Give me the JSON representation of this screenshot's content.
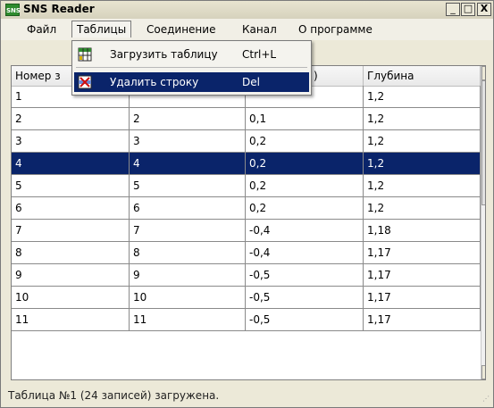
{
  "window": {
    "title": "SNS Reader",
    "icon_text": "SNS",
    "controls": [
      "_",
      "□",
      "X"
    ]
  },
  "menu": [
    "Файл",
    "Таблицы",
    "Соединение",
    "Канал",
    "О программе"
  ],
  "dropdown": [
    {
      "label": "Загрузить таблицу",
      "shortcut": "Ctrl+L",
      "icon": "load-table-icon"
    },
    {
      "label": "Удалить строку",
      "shortcut": "Del",
      "icon": "delete-row-icon"
    }
  ],
  "table": {
    "headers": [
      "Номер з",
      "",
      ")",
      "Глубина"
    ],
    "rows": [
      [
        "1",
        "",
        "",
        "1,2"
      ],
      [
        "2",
        "2",
        "0,1",
        "1,2"
      ],
      [
        "3",
        "3",
        "0,2",
        "1,2"
      ],
      [
        "4",
        "4",
        "0,2",
        "1,2"
      ],
      [
        "5",
        "5",
        "0,2",
        "1,2"
      ],
      [
        "6",
        "6",
        "0,2",
        "1,2"
      ],
      [
        "7",
        "7",
        "-0,4",
        "1,18"
      ],
      [
        "8",
        "8",
        "-0,4",
        "1,17"
      ],
      [
        "9",
        "9",
        "-0,5",
        "1,17"
      ],
      [
        "10",
        "10",
        "-0,5",
        "1,17"
      ],
      [
        "11",
        "11",
        "-0,5",
        "1,17"
      ]
    ],
    "selected_row": 3
  },
  "status": {
    "text": "Таблица №1 (24 записей) загружена."
  },
  "colors": {
    "selection": "#0a246a",
    "app_icon": "#2e8b2e"
  }
}
